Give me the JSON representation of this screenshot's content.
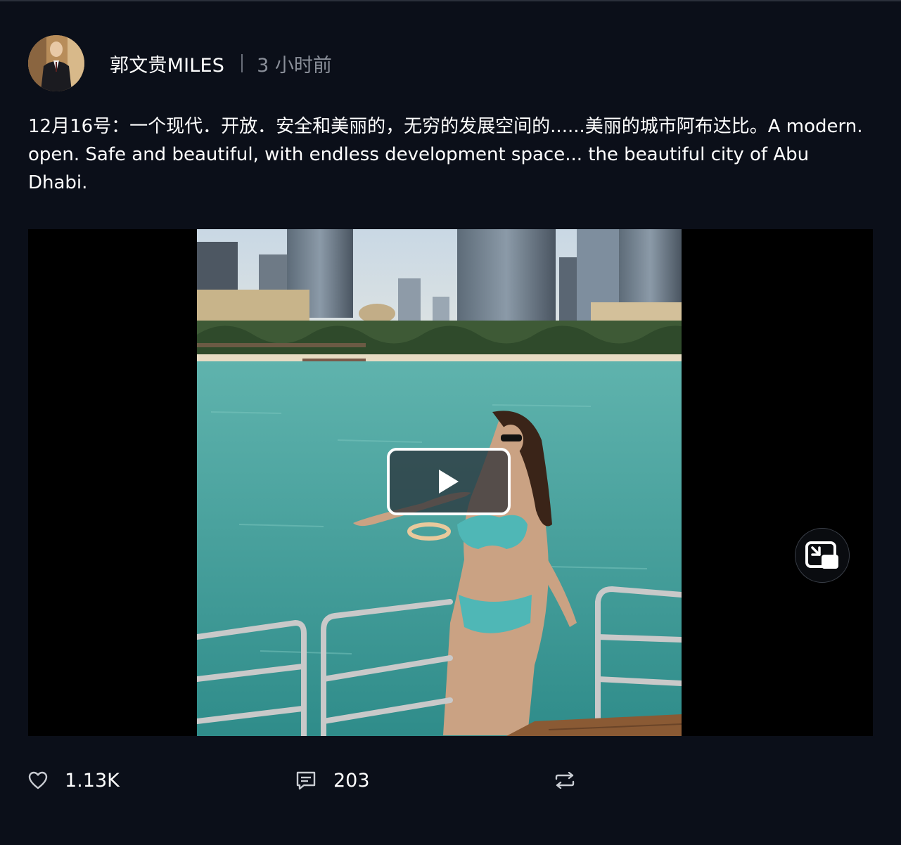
{
  "post": {
    "author": "郭文贵MILES",
    "time": "3 小时前",
    "text": "12月16号：一个现代．开放．安全和美丽的，无穷的发展空间的......美丽的城市阿布达比。A modern. open. Safe and beautiful, with endless development space... the beautiful city of Abu Dhabi."
  },
  "video": {
    "play_icon": "play-icon",
    "pip_icon": "picture-in-picture-icon"
  },
  "actions": {
    "like": {
      "icon": "heart-icon",
      "count": "1.13K"
    },
    "comment": {
      "icon": "comment-icon",
      "count": "203"
    },
    "repost": {
      "icon": "repost-icon"
    }
  },
  "colors": {
    "background": "#0b0f19",
    "text": "#ffffff",
    "muted": "#8a8f99",
    "video_bg": "#000000"
  }
}
